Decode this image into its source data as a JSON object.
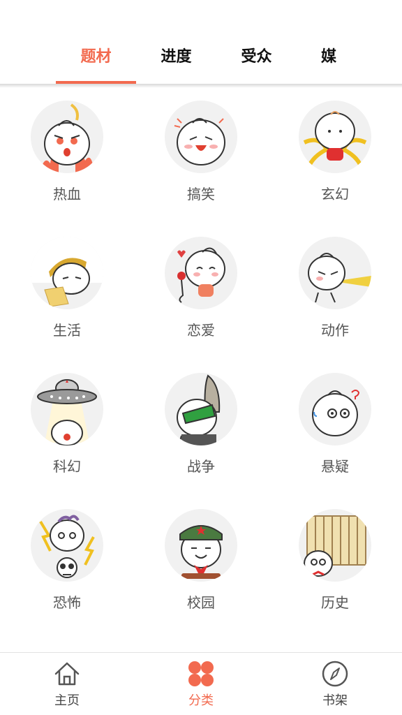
{
  "tabs": [
    {
      "label": "题材",
      "active": true
    },
    {
      "label": "进度",
      "active": false
    },
    {
      "label": "受众",
      "active": false
    },
    {
      "label": "媒体",
      "active": false
    }
  ],
  "categories": [
    {
      "label": "热血",
      "icon": "bun-fire-icon"
    },
    {
      "label": "搞笑",
      "icon": "bun-laugh-icon"
    },
    {
      "label": "玄幻",
      "icon": "bun-fantasy-icon"
    },
    {
      "label": "生活",
      "icon": "bun-life-icon"
    },
    {
      "label": "恋爱",
      "icon": "bun-love-icon"
    },
    {
      "label": "动作",
      "icon": "bun-action-icon"
    },
    {
      "label": "科幻",
      "icon": "bun-ufo-icon"
    },
    {
      "label": "战争",
      "icon": "bun-war-icon"
    },
    {
      "label": "悬疑",
      "icon": "bun-mystery-icon"
    },
    {
      "label": "恐怖",
      "icon": "bun-horror-icon"
    },
    {
      "label": "校园",
      "icon": "bun-school-icon"
    },
    {
      "label": "历史",
      "icon": "bun-history-icon"
    }
  ],
  "bottom_nav": [
    {
      "label": "主页",
      "icon": "home-icon",
      "active": false
    },
    {
      "label": "分类",
      "icon": "category-grid-icon",
      "active": true
    },
    {
      "label": "书架",
      "icon": "compass-icon",
      "active": false
    }
  ],
  "colors": {
    "accent": "#f26a4f",
    "avatar_bg": "#f1f1f1"
  }
}
